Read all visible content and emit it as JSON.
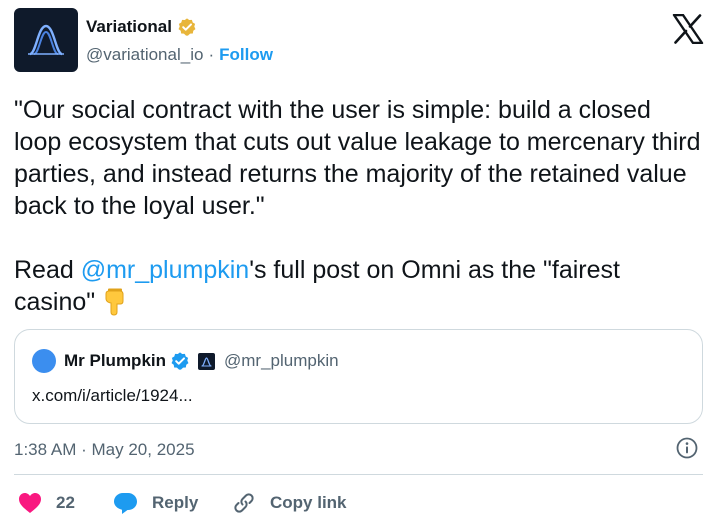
{
  "author": {
    "display_name": "Variational",
    "handle": "@variational_io",
    "separator": "·",
    "follow_label": "Follow",
    "verified": "gold",
    "accent": "#1d9bf0"
  },
  "tweet": {
    "quote_text": "\"Our social contract with the user is simple: build a closed loop ecosystem that cuts out value leakage to mercenary third parties, and instead returns the majority of the retained value back to the loyal user.\"",
    "read_prefix": "Read ",
    "mention": "@mr_plumpkin",
    "read_suffix": "'s full post on Omni as the \"fairest casino\"",
    "emoji": "backhand-index-pointing-down"
  },
  "quoted": {
    "display_name": "Mr Plumpkin",
    "handle": "@mr_plumpkin",
    "link_text": "x.com/i/article/1924...",
    "verified": "blue"
  },
  "meta": {
    "time": "1:38 AM",
    "separator": "·",
    "date": "May 20, 2025"
  },
  "actions": {
    "like_count": "22",
    "reply_label": "Reply",
    "copy_label": "Copy link",
    "like_color": "#f91880",
    "reply_color": "#1d9bf0"
  },
  "icons": [
    "x-logo",
    "info-icon",
    "heart-icon",
    "reply-bubble-icon",
    "link-icon"
  ]
}
